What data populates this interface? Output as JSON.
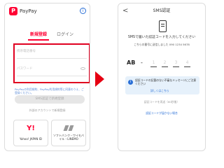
{
  "left": {
    "app_name": "PayPay",
    "logo_letter": "P",
    "info_glyph": "i",
    "tabs": [
      {
        "label": "新規登録"
      },
      {
        "label": "ログイン"
      }
    ],
    "phone_placeholder": "携帯電話番号",
    "password_placeholder": "パスワード",
    "terms_text": "PayPayの利用規約、PayPay利用規約等に同意のうえ、ご登録ください。",
    "login_button": "SMS認証で新規登録",
    "other_accounts": "外部のアカウントで新規登録",
    "yahoo_logo": "Y!",
    "yahoo_label": "Yahoo! JAPAN ID",
    "softbank_label": "ソフトバンク・ワイモバイル・LINEMO",
    "accent_color": "#ff0033"
  },
  "arrow_color": "#e60012",
  "right": {
    "back_glyph": "<",
    "title": "SMS認証",
    "heading": "SMSで届いた認証コードを入力してください",
    "sub": "こちらの番号に送信しました 090 1234 5678",
    "code_prefix": "AB",
    "code_dash": "-",
    "code_digits": [
      "1",
      "2",
      "3",
      "4"
    ],
    "notice_icon_glyph": "i",
    "notice": "認証コードの記載のない不審なメッセージにご注意ください",
    "notice_link": "詳しくはこちら",
    "resend": "認証コードを再送（60秒後）",
    "help": "認証コードが届かない場合"
  }
}
